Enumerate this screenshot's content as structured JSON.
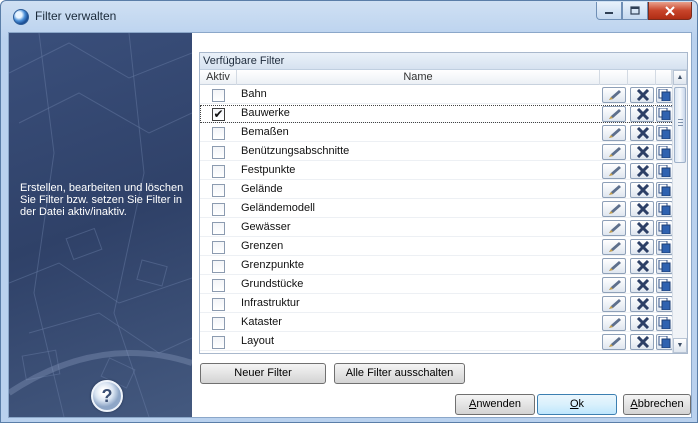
{
  "window": {
    "title": "Filter verwalten",
    "icon": "globe-icon",
    "controls": [
      "minimize-icon",
      "maximize-icon",
      "close-icon"
    ]
  },
  "left_panel": {
    "description": "Erstellen, bearbeiten und löschen Sie Filter bzw. setzen Sie Filter in der Datei aktiv/inaktiv.",
    "help_icon": "help-icon"
  },
  "filter_box": {
    "title": "Verfügbare Filter",
    "columns": {
      "aktiv": "Aktiv",
      "name": "Name"
    },
    "rows": [
      {
        "name": "Bahn",
        "active": false
      },
      {
        "name": "Bauwerke",
        "active": true
      },
      {
        "name": "Bemaßen",
        "active": false
      },
      {
        "name": "Benützungsabschnitte",
        "active": false
      },
      {
        "name": "Festpunkte",
        "active": false
      },
      {
        "name": "Gelände",
        "active": false
      },
      {
        "name": "Geländemodell",
        "active": false
      },
      {
        "name": "Gewässer",
        "active": false
      },
      {
        "name": "Grenzen",
        "active": false
      },
      {
        "name": "Grenzpunkte",
        "active": false
      },
      {
        "name": "Grundstücke",
        "active": false
      },
      {
        "name": "Infrastruktur",
        "active": false
      },
      {
        "name": "Kataster",
        "active": false
      },
      {
        "name": "Layout",
        "active": false
      }
    ],
    "row_actions": [
      "edit-icon",
      "delete-icon",
      "copy-icon"
    ]
  },
  "buttons": {
    "neuer_filter": "Neuer Filter",
    "alle_filter_ausschalten": "Alle Filter ausschalten",
    "anwenden": {
      "pre": "",
      "accel": "A",
      "post": "nwenden"
    },
    "ok": {
      "pre": "",
      "accel": "O",
      "post": "k"
    },
    "abbrechen": {
      "pre": "",
      "accel": "A",
      "post": "bbrechen"
    }
  },
  "colors": {
    "title_bar": "#b9d1ee",
    "close_button": "#c8442a",
    "left_panel": "#2f4168",
    "default_button_border": "#3c7fb1"
  }
}
